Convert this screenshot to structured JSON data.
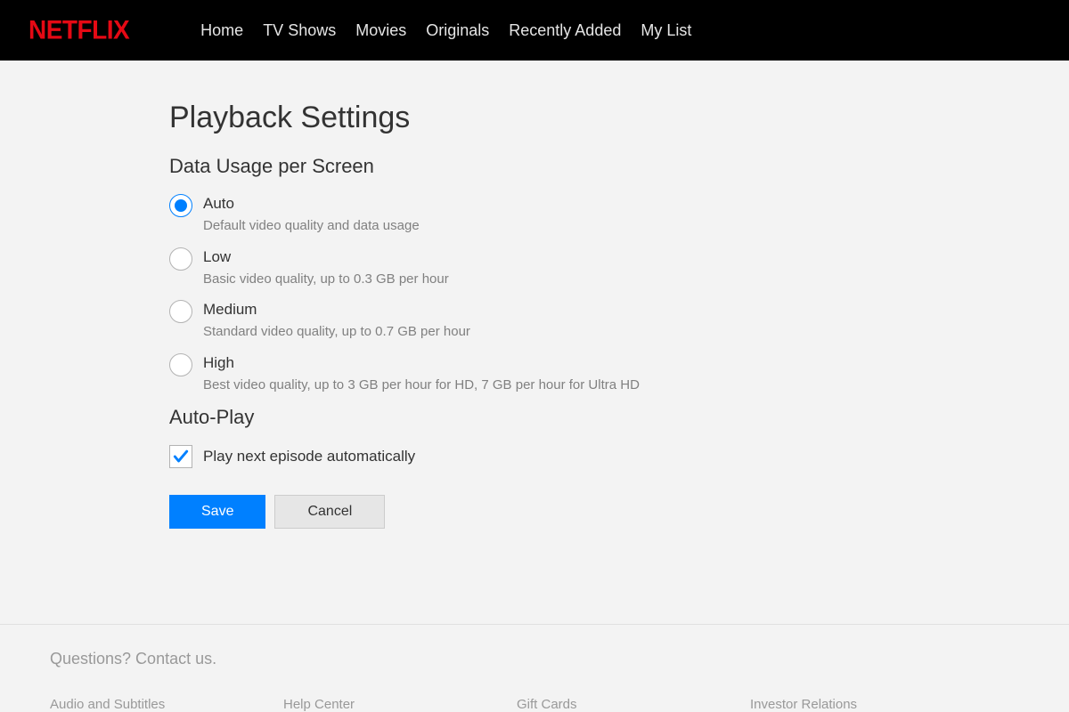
{
  "brand": "NETFLIX",
  "nav": {
    "items": [
      "Home",
      "TV Shows",
      "Movies",
      "Originals",
      "Recently Added",
      "My List"
    ]
  },
  "page": {
    "title": "Playback Settings",
    "data_usage_heading": "Data Usage per Screen",
    "options": [
      {
        "label": "Auto",
        "desc": "Default video quality and data usage",
        "selected": true
      },
      {
        "label": "Low",
        "desc": "Basic video quality, up to 0.3 GB per hour",
        "selected": false
      },
      {
        "label": "Medium",
        "desc": "Standard video quality, up to 0.7 GB per hour",
        "selected": false
      },
      {
        "label": "High",
        "desc": "Best video quality, up to 3 GB per hour for HD, 7 GB per hour for Ultra HD",
        "selected": false
      }
    ],
    "autoplay_heading": "Auto-Play",
    "autoplay_label": "Play next episode automatically",
    "autoplay_checked": true,
    "save_label": "Save",
    "cancel_label": "Cancel"
  },
  "footer": {
    "contact": "Questions? Contact us.",
    "links": [
      "Audio and Subtitles",
      "Help Center",
      "Gift Cards",
      "Investor Relations"
    ]
  }
}
